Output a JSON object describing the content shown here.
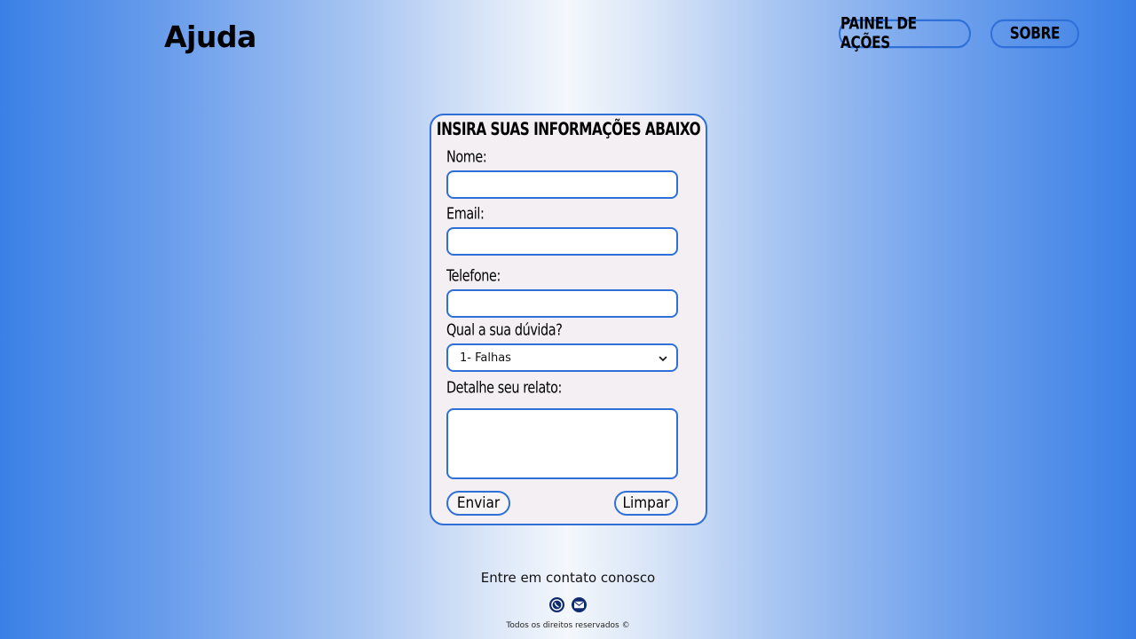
{
  "header": {
    "title": "Ajuda",
    "nav": {
      "acoes_label": "PAINEL DE AÇÕES",
      "sobre_label": "SOBRE"
    }
  },
  "form": {
    "heading": "INSIRA SUAS INFORMAÇÕES ABAIXO",
    "nome_label": "Nome:",
    "email_label": "Email:",
    "telefone_label": "Telefone:",
    "duvida_label": "Qual a sua dúvida?",
    "duvida_value": "1- Falhas",
    "relato_label": "Detalhe seu relato:",
    "enviar_label": "Enviar",
    "limpar_label": "Limpar",
    "nome_value": "",
    "email_value": "",
    "telefone_value": ""
  },
  "footer": {
    "contact_text": "Entre em contato conosco",
    "icons": [
      "whatsapp-icon",
      "mail-icon"
    ],
    "rights_text": "Todos os direitos reservados ©"
  },
  "colors": {
    "accent": "#2f6fd8",
    "card_bg": "#f3eff2",
    "background_edge": "#3a80e6",
    "background_center": "#f4f7fc"
  }
}
